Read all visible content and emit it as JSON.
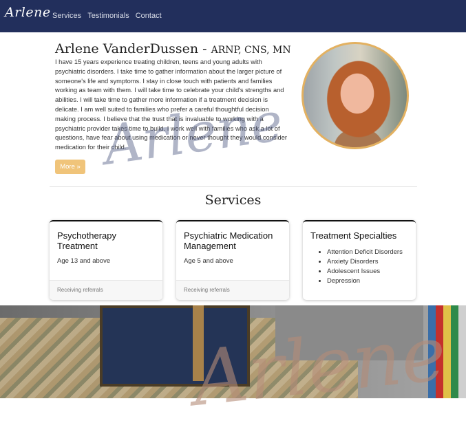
{
  "nav": {
    "brand": "Arlene",
    "links": [
      "Services",
      "Testimonials",
      "Contact"
    ]
  },
  "hero": {
    "name": "Arlene VanderDussen - ",
    "credentials": "ARNP, CNS, MN",
    "bio": "I have 15 years experience treating children, teens and young adults with psychiatric disorders. I take time to gather information about the larger picture of someone's life and symptoms. I stay in close touch with patients and families working as team with them. I will take time to celebrate your child's strengths and abilities. I will take time to gather more information if a treatment decision is delicate. I am well suited to families who prefer a careful thoughtful decision making process. I believe that the trust that is invaluable to working with a psychiatric provider takes time to build. I work well with families who ask a lot of questions, have fear about using medication or never thought they would consider medication for their child.",
    "more_button": "More »",
    "watermark": "Arlene"
  },
  "services": {
    "title": "Services",
    "cards": [
      {
        "title": "Psychotherapy Treatment",
        "text": "Age 13 and above",
        "footer": "Receiving referrals"
      },
      {
        "title": "Psychiatric Medication Management",
        "text": "Age 5 and above",
        "footer": "Receiving referrals"
      },
      {
        "title": "Treatment Specialties",
        "items": [
          "Attention Deficit Disorders",
          "Anxiety Disorders",
          "Adolescent Issues",
          "Depression"
        ]
      }
    ]
  },
  "photo": {
    "watermark": "Arlene"
  },
  "colors": {
    "nav_bg": "#222f5c",
    "accent": "#f0c47a",
    "portrait_border": "#e3b161"
  }
}
